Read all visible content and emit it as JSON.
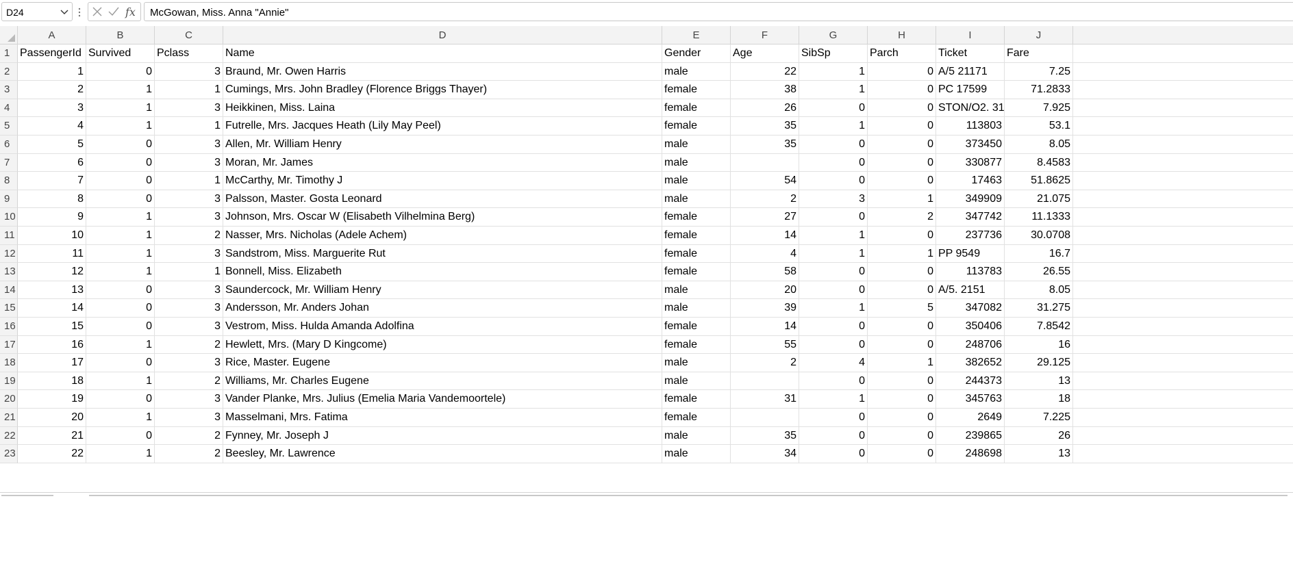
{
  "formula_bar": {
    "name_box": "D24",
    "formula": "McGowan, Miss. Anna \"Annie\"",
    "fx_label": "fx",
    "icons": [
      "chevron-down-icon",
      "more-dots-icon",
      "cancel-icon",
      "enter-icon",
      "function-icon"
    ]
  },
  "columns": [
    "A",
    "B",
    "C",
    "D",
    "E",
    "F",
    "G",
    "H",
    "I",
    "J"
  ],
  "header_row": {
    "row_num": "1",
    "cells": [
      "PassengerId",
      "Survived",
      "Pclass",
      "Name",
      "Gender",
      "Age",
      "SibSp",
      "Parch",
      "Ticket",
      "Fare"
    ]
  },
  "rows": [
    {
      "row_num": "2",
      "cells": [
        "1",
        "0",
        "3",
        "Braund, Mr. Owen Harris",
        "male",
        "22",
        "1",
        "0",
        "A/5 21171",
        "7.25"
      ]
    },
    {
      "row_num": "3",
      "cells": [
        "2",
        "1",
        "1",
        "Cumings, Mrs. John Bradley (Florence Briggs Thayer)",
        "female",
        "38",
        "1",
        "0",
        "PC 17599",
        "71.2833"
      ]
    },
    {
      "row_num": "4",
      "cells": [
        "3",
        "1",
        "3",
        "Heikkinen, Miss. Laina",
        "female",
        "26",
        "0",
        "0",
        "STON/O2. 31",
        "7.925"
      ]
    },
    {
      "row_num": "5",
      "cells": [
        "4",
        "1",
        "1",
        "Futrelle, Mrs. Jacques Heath (Lily May Peel)",
        "female",
        "35",
        "1",
        "0",
        "113803",
        "53.1"
      ]
    },
    {
      "row_num": "6",
      "cells": [
        "5",
        "0",
        "3",
        "Allen, Mr. William Henry",
        "male",
        "35",
        "0",
        "0",
        "373450",
        "8.05"
      ]
    },
    {
      "row_num": "7",
      "cells": [
        "6",
        "0",
        "3",
        "Moran, Mr. James",
        "male",
        "",
        "0",
        "0",
        "330877",
        "8.4583"
      ]
    },
    {
      "row_num": "8",
      "cells": [
        "7",
        "0",
        "1",
        "McCarthy, Mr. Timothy J",
        "male",
        "54",
        "0",
        "0",
        "17463",
        "51.8625"
      ]
    },
    {
      "row_num": "9",
      "cells": [
        "8",
        "0",
        "3",
        "Palsson, Master. Gosta Leonard",
        "male",
        "2",
        "3",
        "1",
        "349909",
        "21.075"
      ]
    },
    {
      "row_num": "10",
      "cells": [
        "9",
        "1",
        "3",
        "Johnson, Mrs. Oscar W (Elisabeth Vilhelmina Berg)",
        "female",
        "27",
        "0",
        "2",
        "347742",
        "11.1333"
      ]
    },
    {
      "row_num": "11",
      "cells": [
        "10",
        "1",
        "2",
        "Nasser, Mrs. Nicholas (Adele Achem)",
        "female",
        "14",
        "1",
        "0",
        "237736",
        "30.0708"
      ]
    },
    {
      "row_num": "12",
      "cells": [
        "11",
        "1",
        "3",
        "Sandstrom, Miss. Marguerite Rut",
        "female",
        "4",
        "1",
        "1",
        "PP 9549",
        "16.7"
      ]
    },
    {
      "row_num": "13",
      "cells": [
        "12",
        "1",
        "1",
        "Bonnell, Miss. Elizabeth",
        "female",
        "58",
        "0",
        "0",
        "113783",
        "26.55"
      ]
    },
    {
      "row_num": "14",
      "cells": [
        "13",
        "0",
        "3",
        "Saundercock, Mr. William Henry",
        "male",
        "20",
        "0",
        "0",
        "A/5. 2151",
        "8.05"
      ]
    },
    {
      "row_num": "15",
      "cells": [
        "14",
        "0",
        "3",
        "Andersson, Mr. Anders Johan",
        "male",
        "39",
        "1",
        "5",
        "347082",
        "31.275"
      ]
    },
    {
      "row_num": "16",
      "cells": [
        "15",
        "0",
        "3",
        "Vestrom, Miss. Hulda Amanda Adolfina",
        "female",
        "14",
        "0",
        "0",
        "350406",
        "7.8542"
      ]
    },
    {
      "row_num": "17",
      "cells": [
        "16",
        "1",
        "2",
        "Hewlett, Mrs. (Mary D Kingcome)",
        "female",
        "55",
        "0",
        "0",
        "248706",
        "16"
      ]
    },
    {
      "row_num": "18",
      "cells": [
        "17",
        "0",
        "3",
        "Rice, Master. Eugene",
        "male",
        "2",
        "4",
        "1",
        "382652",
        "29.125"
      ]
    },
    {
      "row_num": "19",
      "cells": [
        "18",
        "1",
        "2",
        "Williams, Mr. Charles Eugene",
        "male",
        "",
        "0",
        "0",
        "244373",
        "13"
      ]
    },
    {
      "row_num": "20",
      "cells": [
        "19",
        "0",
        "3",
        "Vander Planke, Mrs. Julius (Emelia Maria Vandemoortele)",
        "female",
        "31",
        "1",
        "0",
        "345763",
        "18"
      ]
    },
    {
      "row_num": "21",
      "cells": [
        "20",
        "1",
        "3",
        "Masselmani, Mrs. Fatima",
        "female",
        "",
        "0",
        "0",
        "2649",
        "7.225"
      ]
    },
    {
      "row_num": "22",
      "cells": [
        "21",
        "0",
        "2",
        "Fynney, Mr. Joseph J",
        "male",
        "35",
        "0",
        "0",
        "239865",
        "26"
      ]
    },
    {
      "row_num": "23",
      "cells": [
        "22",
        "1",
        "2",
        "Beesley, Mr. Lawrence",
        "male",
        "34",
        "0",
        "0",
        "248698",
        "13"
      ]
    }
  ],
  "colors": {
    "header_bg": "#f3f3f3",
    "gridline": "#e1e1e1",
    "header_border": "#d4d4d4"
  }
}
